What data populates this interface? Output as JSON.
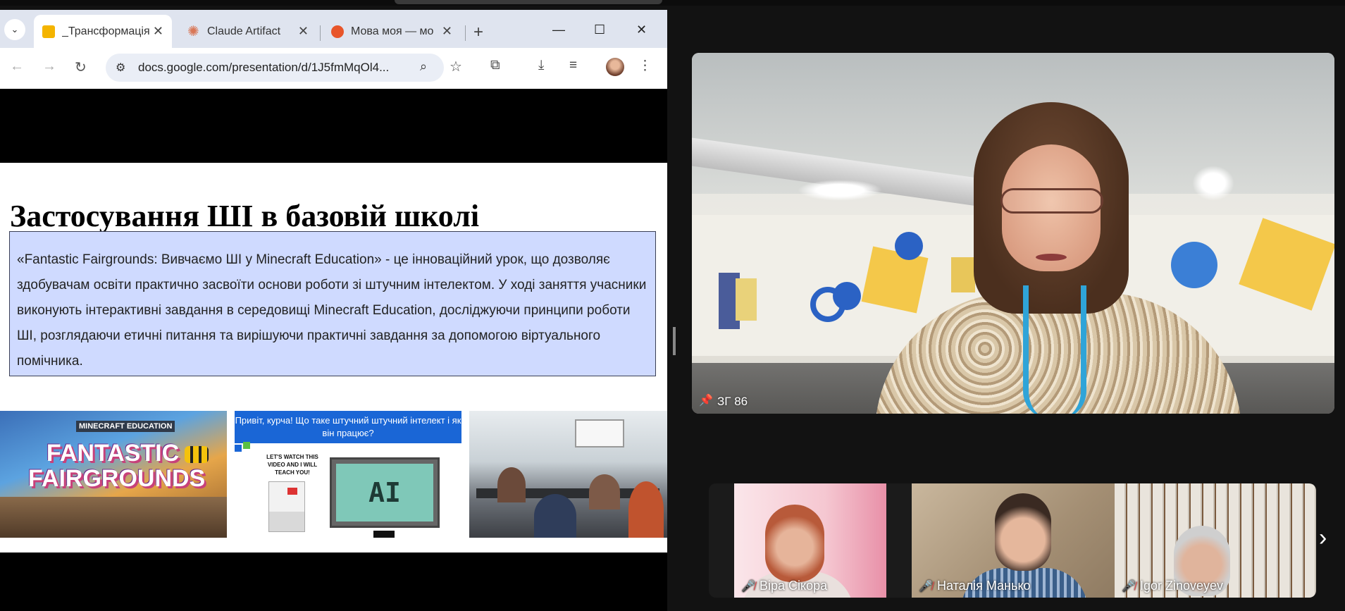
{
  "browser": {
    "tabs": [
      {
        "title": "_Трансформація",
        "favicon_color": "#f4b400",
        "active": true
      },
      {
        "title": "Claude Artifact",
        "favicon_color": "#d97757",
        "active": false
      },
      {
        "title": "Мова моя — мо",
        "favicon_color": "#e8552a",
        "active": false
      }
    ],
    "new_tab_symbol": "+",
    "window_controls": {
      "minimize": "—",
      "maximize": "☐",
      "close": "✕"
    },
    "url": "docs.google.com/presentation/d/1J5fmMqOl4..."
  },
  "slide": {
    "title": "Застосування ШІ в базовій школі",
    "body": "«Fantastic Fairgrounds: Вивчаємо ШІ у Minecraft Education» - це інноваційний урок, що дозволяє здобувачам освіти практично засвоїти основи роботи зі штучним інтелектом. У ході заняття учасники виконують інтерактивні завдання в середовищі Minecraft Education, досліджуючи принципи роботи ШІ, розглядаючи етичні питання та вирішуючи практичні завдання за допомогою віртуального помічника.",
    "images": {
      "game": {
        "label": "MINECRAFT EDUCATION",
        "title": "FANTASTIC FAIRGROUNDS"
      },
      "video_card": {
        "banner": "Привіт, курча! Що таке штучний штучний інтелект і як він працює?",
        "speech": "LET'S WATCH THIS VIDEO AND I WILL TEACH YOU!",
        "screen_text": "AI"
      }
    }
  },
  "call": {
    "main_label": "ЗГ 86",
    "participants": [
      {
        "name": "Віра Сікора",
        "muted": true
      },
      {
        "name": "Наталія Манько",
        "muted": true
      },
      {
        "name": "Igor Zinoveyev",
        "muted": true
      }
    ]
  }
}
